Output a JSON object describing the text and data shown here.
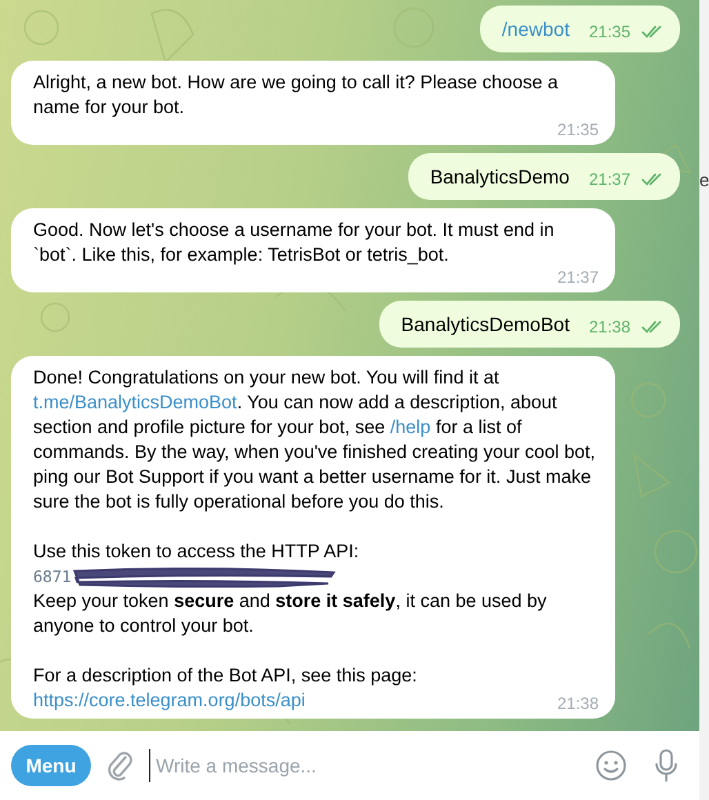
{
  "messages": [
    {
      "kind": "outgoing",
      "parts": [
        {
          "kind": "command",
          "text": "/newbot"
        }
      ],
      "time": "21:35",
      "read": true
    },
    {
      "kind": "incoming",
      "paragraphs": [
        {
          "lines": [
            [
              {
                "kind": "text",
                "text": "Alright, a new bot. How are we going to call it? Please choose a name for your bot."
              }
            ]
          ]
        }
      ],
      "time": "21:35"
    },
    {
      "kind": "outgoing",
      "parts": [
        {
          "kind": "text",
          "text": "BanalyticsDemo"
        }
      ],
      "time": "21:37",
      "read": true
    },
    {
      "kind": "incoming",
      "paragraphs": [
        {
          "lines": [
            [
              {
                "kind": "text",
                "text": "Good. Now let's choose a username for your bot. It must end in `bot`. Like this, for example: TetrisBot or tetris_bot."
              }
            ]
          ]
        }
      ],
      "time": "21:37"
    },
    {
      "kind": "outgoing",
      "parts": [
        {
          "kind": "text",
          "text": "BanalyticsDemoBot"
        }
      ],
      "time": "21:38",
      "read": true
    },
    {
      "kind": "incoming",
      "paragraphs": [
        {
          "lines": [
            [
              {
                "kind": "text",
                "text": "Done! Congratulations on your new bot. You will find it at "
              },
              {
                "kind": "link",
                "text": "t.me/BanalyticsDemoBot"
              },
              {
                "kind": "text",
                "text": ". You can now add a description, about section and profile picture for your bot, see "
              },
              {
                "kind": "link",
                "text": "/help"
              },
              {
                "kind": "text",
                "text": " for a list of commands. By the way, when you've finished creating your cool bot, ping our Bot Support if you want a better username for it. Just make sure the bot is fully operational before you do this."
              }
            ]
          ]
        },
        {
          "lines": [
            [
              {
                "kind": "text",
                "text": "Use this token to access the HTTP API:"
              }
            ],
            [
              {
                "kind": "token",
                "text": "6871"
              }
            ],
            [
              {
                "kind": "text",
                "text": "Keep your token **secure** and **store it safely**, it can be used by anyone to control your bot."
              }
            ]
          ]
        },
        {
          "lines": [
            [
              {
                "kind": "text",
                "text": "For a description of the Bot API, see this page:"
              }
            ],
            [
              {
                "kind": "link",
                "text": "https://core.telegram.org/bots/api"
              }
            ]
          ]
        }
      ],
      "time": "21:38"
    }
  ],
  "side_fragment": "e",
  "composer": {
    "menu_label": "Menu",
    "placeholder": "Write a message..."
  }
}
